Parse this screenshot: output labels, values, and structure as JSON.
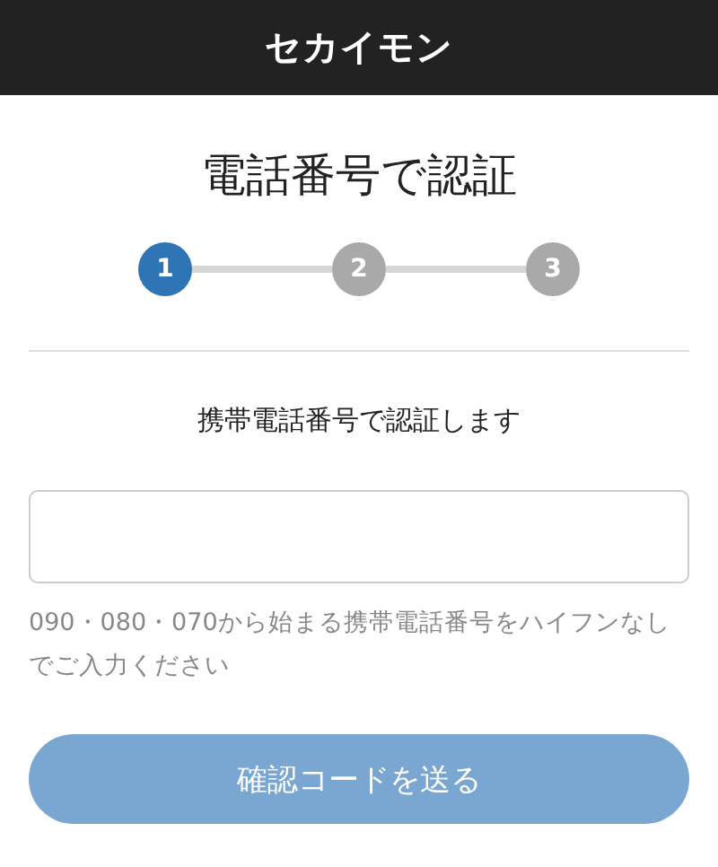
{
  "header": {
    "logo": "セカイモン"
  },
  "title": "電話番号で認証",
  "steps": [
    {
      "label": "1",
      "selected": true
    },
    {
      "label": "2",
      "selected": false
    },
    {
      "label": "3",
      "selected": false
    }
  ],
  "subtitle": "携帯電話番号で認証します",
  "help_text": "090・080・070から始まる携帯電話番号をハイフンなしでご入力ください",
  "submit_button": {
    "label": "確認コードを送る",
    "disabled": true
  }
}
